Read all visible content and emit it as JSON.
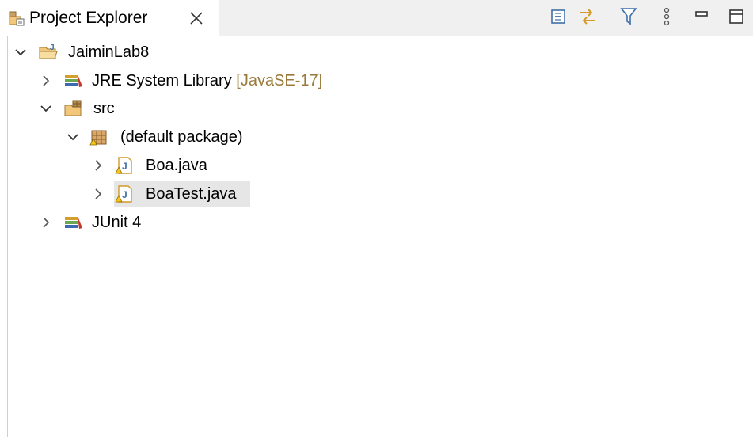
{
  "view": {
    "title": "Project Explorer",
    "close_icon": "close-icon",
    "tab_icon": "project-explorer-icon",
    "toolbar": [
      {
        "name": "collapse-all-icon"
      },
      {
        "name": "link-with-editor-icon"
      },
      {
        "name": "filter-icon"
      },
      {
        "name": "view-menu-icon"
      },
      {
        "name": "minimize-icon"
      },
      {
        "name": "maximize-icon"
      }
    ]
  },
  "tree": {
    "project": {
      "label": "JaiminLab8",
      "expanded": true,
      "icon": "java-project-icon"
    },
    "jre": {
      "label": "JRE System Library",
      "decoration": "[JavaSE-17]",
      "icon": "library-icon"
    },
    "src": {
      "label": "src",
      "expanded": true,
      "icon": "source-folder-icon"
    },
    "package": {
      "label": "(default package)",
      "expanded": true,
      "icon": "package-icon"
    },
    "files": [
      {
        "label": "Boa.java",
        "icon": "java-file-icon",
        "selected": false
      },
      {
        "label": "BoaTest.java",
        "icon": "java-file-icon",
        "selected": true
      }
    ],
    "junit": {
      "label": "JUnit 4",
      "icon": "library-icon"
    }
  },
  "colors": {
    "tab_bar": "#f0f0f0",
    "selection": "#e6e6e6",
    "decoration": "#9a7a3a",
    "toolbar_icon": "#3f6fa8",
    "folder": "#e8a33b"
  }
}
